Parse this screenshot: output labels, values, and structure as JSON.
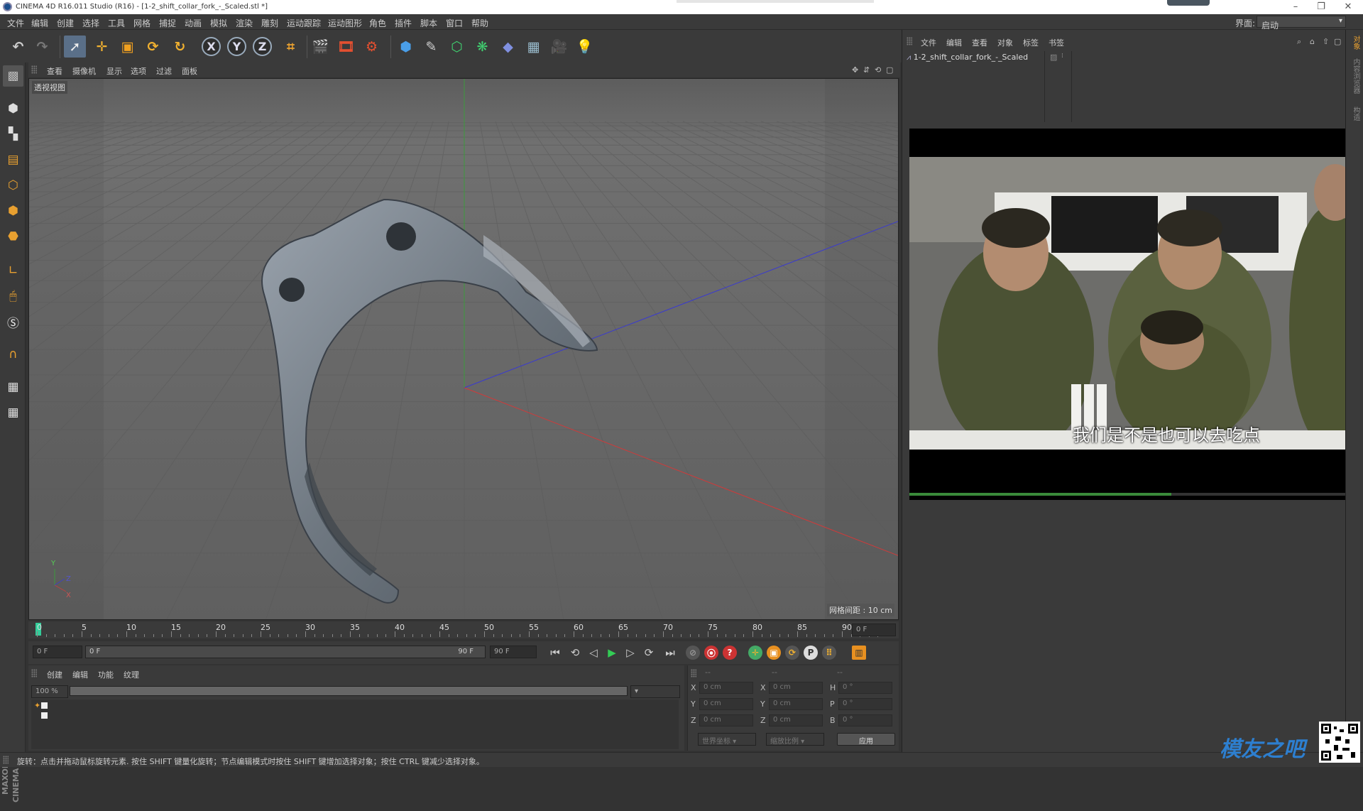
{
  "titlebar": {
    "title": "CINEMA 4D R16.011 Studio (R16) - [1-2_shift_collar_fork_-_Scaled.stl *]"
  },
  "menu": [
    "文件",
    "编辑",
    "创建",
    "选择",
    "工具",
    "网格",
    "捕捉",
    "动画",
    "模拟",
    "渲染",
    "雕刻",
    "运动跟踪",
    "运动图形",
    "角色",
    "插件",
    "脚本",
    "窗口",
    "帮助"
  ],
  "layout": {
    "label": "界面:",
    "value": "启动"
  },
  "toolbar": {
    "undo": "undo-icon",
    "redo": "redo-icon",
    "x": "X",
    "y": "Y",
    "z": "Z"
  },
  "viewport_menu": [
    "查看",
    "摄像机",
    "显示",
    "选项",
    "过滤",
    "面板"
  ],
  "viewport": {
    "label": "透视视图",
    "grid_info": "网格间距 : 10 cm",
    "axis_y": "Y",
    "axis_z": "Z",
    "axis_x": "X"
  },
  "timeline": {
    "ticks": [
      "0",
      "5",
      "10",
      "15",
      "20",
      "25",
      "30",
      "35",
      "40",
      "45",
      "50",
      "55",
      "60",
      "65",
      "70",
      "75",
      "80",
      "85",
      "90"
    ],
    "current_frame": "0 F"
  },
  "playback": {
    "start": "0 F",
    "slider_start": "0 F",
    "slider_end": "90 F",
    "end": "90 F"
  },
  "material_menu": [
    "创建",
    "编辑",
    "功能",
    "纹理"
  ],
  "material": {
    "zoom": "100 %"
  },
  "coords": {
    "header": [
      "--",
      "--",
      "--"
    ],
    "rows": [
      {
        "a": "X",
        "av": "0 cm",
        "b": "X",
        "bv": "0 cm",
        "c": "H",
        "cv": "0 °"
      },
      {
        "a": "Y",
        "av": "0 cm",
        "b": "Y",
        "bv": "0 cm",
        "c": "P",
        "cv": "0 °"
      },
      {
        "a": "Z",
        "av": "0 cm",
        "b": "Z",
        "bv": "0 cm",
        "c": "B",
        "cv": "0 °"
      }
    ],
    "mode": "世界坐标",
    "scale": "缩放比例",
    "apply": "应用"
  },
  "object_menu": [
    "文件",
    "编辑",
    "查看",
    "对象",
    "标签",
    "书签"
  ],
  "object": {
    "name": "1-2_shift_collar_fork_-_Scaled"
  },
  "video": {
    "subtitle": "我们是不是也可以去吃点",
    "progress": 0.6
  },
  "right_tabs": [
    "对象",
    "内容浏览器",
    "构造"
  ],
  "status": {
    "text": "旋转：点击并拖动鼠标旋转元素. 按住 SHIFT 键量化旋转；节点编辑模式时按住 SHIFT 键增加选择对象；按住 CTRL 键减少选择对象。"
  },
  "watermark": {
    "text": "模友之吧"
  }
}
